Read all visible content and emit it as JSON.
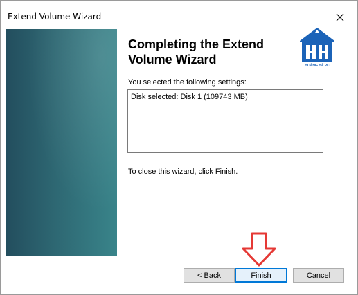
{
  "window": {
    "title": "Extend Volume Wizard",
    "close_symbol": "×"
  },
  "content": {
    "heading": "Completing the Extend Volume Wizard",
    "settings_intro": "You selected the following settings:",
    "settings": [
      "Disk selected: Disk 1 (109743 MB)"
    ],
    "close_note": "To close this wizard, click Finish."
  },
  "logo": {
    "caption": "HOÀNG HÀ PC",
    "monogram": "HH",
    "color": "#1b63b8"
  },
  "buttons": {
    "back": "< Back",
    "finish": "Finish",
    "cancel": "Cancel"
  },
  "annotation": {
    "arrow_color": "#e53935"
  }
}
